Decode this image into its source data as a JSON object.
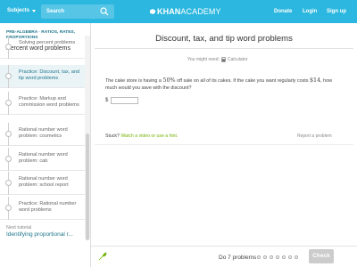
{
  "header": {
    "subjects_label": "Subjects",
    "search_placeholder": "Search",
    "logo_k": "KHAN",
    "logo_rest": "ACADEMY",
    "donate": "Donate",
    "login": "Login",
    "signup": "Sign up"
  },
  "sidebar": {
    "breadcrumb": "PRE-ALGEBRA · RATIOS, RATES, PROPORTIONS",
    "topic_title": "Percent word problems",
    "items": [
      {
        "label": "Solving percent problems"
      },
      {
        "label": "Practice: Discount, tax, and tip word problems"
      },
      {
        "label": "Practice: Markup and commission word problems"
      },
      {
        "label": "Rational number word problem: cosmetics"
      },
      {
        "label": "Rational number word problem: cab"
      },
      {
        "label": "Rational number word problem: school report"
      },
      {
        "label": "Practice: Rational number word problems"
      }
    ],
    "next_label": "Next tutorial",
    "next_link": "Identifying proportional r..."
  },
  "main": {
    "title": "Discount, tax, and tip word problems",
    "needs_label": "You might need:",
    "calculator_label": "Calculator",
    "problem_part1": "The cake store is having a ",
    "problem_percent": "50%",
    "problem_part2": " off sale on all of its cakes. If the cake you want regularly costs ",
    "problem_price": "$14",
    "problem_part3": ", how much would you save with the discount?",
    "currency": "$",
    "answer_value": "",
    "stuck_label": "Stuck?",
    "hint_label": "Watch a video or use a hint.",
    "report_label": "Report a problem"
  },
  "footer": {
    "do_label": "Do 7 problems",
    "check_label": "Check"
  },
  "colors": {
    "topbar": "#2bb7df",
    "accent": "#1c758a",
    "hint": "#71b307"
  }
}
